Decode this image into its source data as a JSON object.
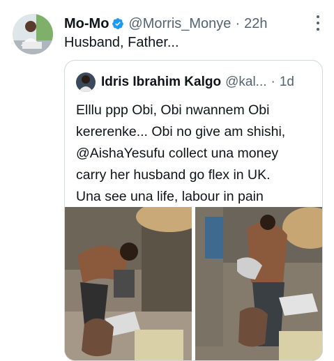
{
  "tweet": {
    "author_name": "Mo-Mo",
    "handle": "@Morris_Monye",
    "separator": "·",
    "time": "22h",
    "text": "Husband, Father...",
    "icons": {
      "verified": "verified-badge-icon",
      "more": "more-options-icon"
    },
    "colors": {
      "verified": "#1d9bf0",
      "secondary_text": "#536471",
      "border": "#cfd9de"
    }
  },
  "quote": {
    "author_name": "Idris Ibrahim Kalgo",
    "handle": "@kal...",
    "separator": "·",
    "time": "1d",
    "lines": [
      "Elllu ppp Obi, Obi nwannem Obi",
      "kererenke... Obi no give am shishi,",
      "@AishaYesufu collect una money",
      "carry her husband go flex in UK.",
      "Una see una life, labour in pain"
    ]
  }
}
